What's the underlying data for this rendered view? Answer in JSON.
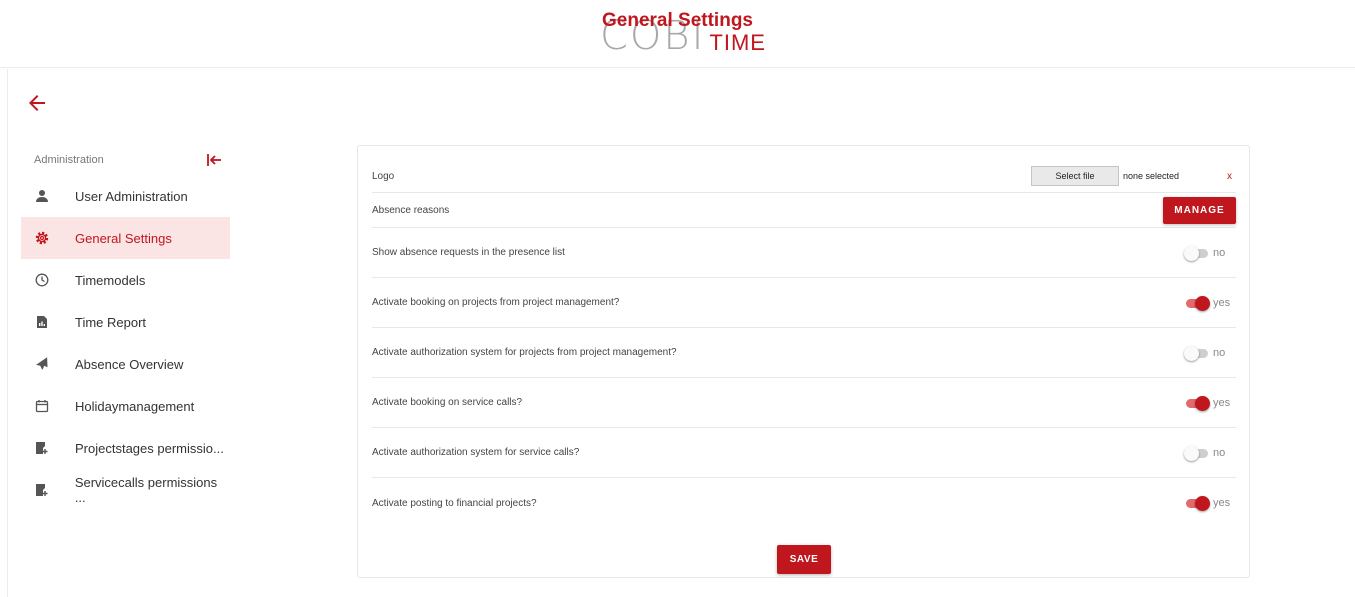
{
  "app": {
    "logo_main": "COBI",
    "logo_sub": "TIME",
    "accent_color": "#c0161d"
  },
  "page": {
    "title": "General Settings",
    "back_icon": "arrow-left-icon"
  },
  "sidebar": {
    "header": "Administration",
    "collapse_icon": "collapse-left-icon",
    "items": [
      {
        "label": "User Administration",
        "icon": "user-icon",
        "active": false
      },
      {
        "label": "General Settings",
        "icon": "gear-icon",
        "active": true
      },
      {
        "label": "Timemodels",
        "icon": "clock-icon",
        "active": false
      },
      {
        "label": "Time Report",
        "icon": "report-icon",
        "active": false
      },
      {
        "label": "Absence Overview",
        "icon": "plane-icon",
        "active": false
      },
      {
        "label": "Holidaymanagement",
        "icon": "calendar-icon",
        "active": false
      },
      {
        "label": "Projectstages permissio...",
        "icon": "permission-icon",
        "active": false
      },
      {
        "label": "Servicecalls permissions ...",
        "icon": "permission-icon",
        "active": false
      }
    ]
  },
  "settings": {
    "logo": {
      "label": "Logo",
      "select_button": "Select file",
      "file_status": "none selected",
      "clear": "x"
    },
    "absence_reasons": {
      "label": "Absence reasons",
      "button": "MANAGE"
    },
    "toggles": [
      {
        "label": "Show absence requests in the presence list",
        "on": false,
        "state_text": "no"
      },
      {
        "label": "Activate booking on projects from project management?",
        "on": true,
        "state_text": "yes"
      },
      {
        "label": "Activate authorization system for projects from project management?",
        "on": false,
        "state_text": "no"
      },
      {
        "label": "Activate booking on service calls?",
        "on": true,
        "state_text": "yes"
      },
      {
        "label": "Activate authorization system for service calls?",
        "on": false,
        "state_text": "no"
      },
      {
        "label": "Activate posting to financial projects?",
        "on": true,
        "state_text": "yes"
      }
    ],
    "save_button": "SAVE"
  }
}
